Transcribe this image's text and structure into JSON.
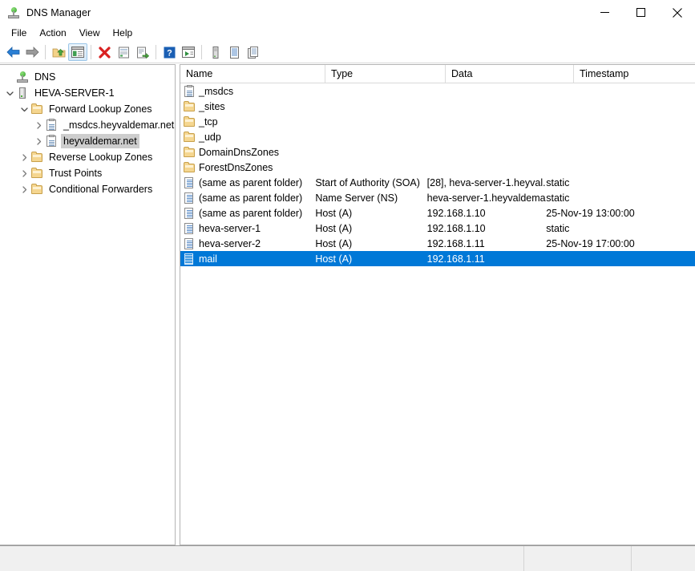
{
  "window": {
    "title": "DNS Manager",
    "icon": "dns-server-icon",
    "controls": {
      "minimize": "minimize-button",
      "maximize": "maximize-button",
      "close": "close-button"
    }
  },
  "menubar": {
    "items": [
      {
        "label": "File"
      },
      {
        "label": "Action"
      },
      {
        "label": "View"
      },
      {
        "label": "Help"
      }
    ]
  },
  "toolbar": {
    "buttons": [
      {
        "name": "back-icon"
      },
      {
        "name": "forward-icon"
      },
      {
        "name": "up-folder-icon"
      },
      {
        "name": "show-hide-console-tree-icon"
      },
      {
        "name": "delete-icon"
      },
      {
        "name": "properties-icon"
      },
      {
        "name": "export-list-icon"
      },
      {
        "name": "help-icon"
      },
      {
        "name": "play-icon"
      },
      {
        "name": "new-server-icon"
      },
      {
        "name": "new-zone-icon"
      },
      {
        "name": "new-record-icon"
      }
    ]
  },
  "tree": {
    "nodes": [
      {
        "label": "DNS",
        "icon": "dns-server-icon",
        "indent": 0,
        "expander": "none",
        "selected": false
      },
      {
        "label": "HEVA-SERVER-1",
        "icon": "server-icon",
        "indent": 1,
        "expander": "expanded",
        "selected": false
      },
      {
        "label": "Forward Lookup Zones",
        "icon": "folder-icon",
        "indent": 2,
        "expander": "expanded",
        "selected": false
      },
      {
        "label": "_msdcs.heyvaldemar.net",
        "icon": "zone-icon",
        "indent": 3,
        "expander": "collapsed",
        "selected": false
      },
      {
        "label": "heyvaldemar.net",
        "icon": "zone-icon",
        "indent": 3,
        "expander": "collapsed",
        "selected": true
      },
      {
        "label": "Reverse Lookup Zones",
        "icon": "folder-icon",
        "indent": 2,
        "expander": "collapsed",
        "selected": false
      },
      {
        "label": "Trust Points",
        "icon": "folder-icon",
        "indent": 2,
        "expander": "collapsed",
        "selected": false
      },
      {
        "label": "Conditional Forwarders",
        "icon": "folder-icon",
        "indent": 2,
        "expander": "collapsed",
        "selected": false
      }
    ]
  },
  "list": {
    "columns": [
      {
        "label": "Name"
      },
      {
        "label": "Type"
      },
      {
        "label": "Data"
      },
      {
        "label": "Timestamp"
      }
    ],
    "rows": [
      {
        "name": "_msdcs",
        "type": "",
        "data": "",
        "timestamp": "",
        "icon": "zone-icon",
        "selected": false
      },
      {
        "name": "_sites",
        "type": "",
        "data": "",
        "timestamp": "",
        "icon": "folder-icon",
        "selected": false
      },
      {
        "name": "_tcp",
        "type": "",
        "data": "",
        "timestamp": "",
        "icon": "folder-icon",
        "selected": false
      },
      {
        "name": "_udp",
        "type": "",
        "data": "",
        "timestamp": "",
        "icon": "folder-icon",
        "selected": false
      },
      {
        "name": "DomainDnsZones",
        "type": "",
        "data": "",
        "timestamp": "",
        "icon": "folder-icon",
        "selected": false
      },
      {
        "name": "ForestDnsZones",
        "type": "",
        "data": "",
        "timestamp": "",
        "icon": "folder-icon",
        "selected": false
      },
      {
        "name": "(same as parent folder)",
        "type": "Start of Authority (SOA)",
        "data": "[28], heva-server-1.heyval...",
        "timestamp": "static",
        "icon": "record-icon",
        "selected": false
      },
      {
        "name": "(same as parent folder)",
        "type": "Name Server (NS)",
        "data": "heva-server-1.heyvaldema...",
        "timestamp": "static",
        "icon": "record-icon",
        "selected": false
      },
      {
        "name": "(same as parent folder)",
        "type": "Host (A)",
        "data": "192.168.1.10",
        "timestamp": "25-Nov-19 13:00:00",
        "icon": "record-icon",
        "selected": false
      },
      {
        "name": "heva-server-1",
        "type": "Host (A)",
        "data": "192.168.1.10",
        "timestamp": "static",
        "icon": "record-icon",
        "selected": false
      },
      {
        "name": "heva-server-2",
        "type": "Host (A)",
        "data": "192.168.1.11",
        "timestamp": "25-Nov-19 17:00:00",
        "icon": "record-icon",
        "selected": false
      },
      {
        "name": "mail",
        "type": "Host (A)",
        "data": "192.168.1.11",
        "timestamp": "",
        "icon": "record-icon",
        "selected": true
      }
    ]
  },
  "statusbar": {
    "text": ""
  },
  "colors": {
    "selection": "#0078d7",
    "tree_selection": "#cdcdcd",
    "folder": "#f5d690",
    "border": "#b4b4b4"
  }
}
